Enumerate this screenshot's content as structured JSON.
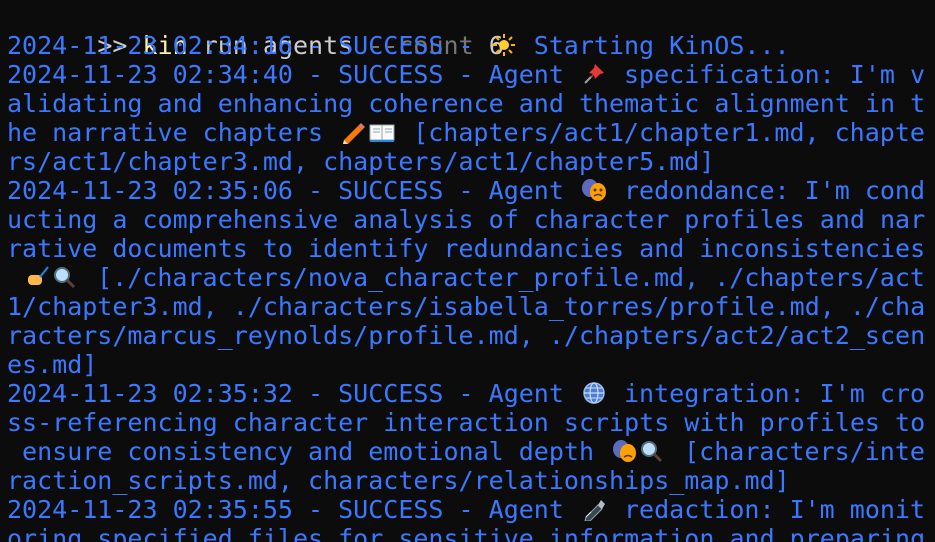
{
  "window": {
    "title": ""
  },
  "command": {
    "prompt": ">>",
    "name": "kin",
    "args": "run agents",
    "flag": "--count",
    "value": "6"
  },
  "lines": [
    {
      "kind": "text",
      "t1": "2024-11-23 02:34:16 - SUCCESS - ",
      "icon": "sun-icon",
      "t2": " Starting KinOS..."
    },
    {
      "kind": "text",
      "t1": "2024-11-23 02:34:40 - SUCCESS - Agent ",
      "icon": "pushpin-icon",
      "t2": " specification: I'm v"
    },
    {
      "kind": "text",
      "t1": "alidating and enhancing coherence and thematic alignment in t"
    },
    {
      "kind": "text",
      "t1": "he narrative chapters ",
      "icon": "pencil-book-icon",
      "t2": " [chapters/act1/chapter1.md, chapte"
    },
    {
      "kind": "text",
      "t1": "rs/act1/chapter3.md, chapters/act1/chapter5.md]"
    },
    {
      "kind": "text",
      "t1": "2024-11-23 02:35:06 - SUCCESS - Agent ",
      "icon": "theater-masks-icon",
      "t2": " redondance: I'm cond"
    },
    {
      "kind": "text",
      "t1": "ucting a comprehensive analysis of character profiles and nar"
    },
    {
      "kind": "text",
      "t1": "rative documents to identify redundancies and inconsistencies"
    },
    {
      "kind": "text",
      "t1": " ",
      "icon": "writing-hand-magnifier-icon",
      "t2": " [./characters/nova_character_profile.md, ./chapters/act"
    },
    {
      "kind": "text",
      "t1": "1/chapter3.md, ./characters/isabella_torres/profile.md, ./cha"
    },
    {
      "kind": "text",
      "t1": "racters/marcus_reynolds/profile.md, ./chapters/act2/act2_scen"
    },
    {
      "kind": "text",
      "t1": "es.md]"
    },
    {
      "kind": "text",
      "t1": "2024-11-23 02:35:32 - SUCCESS - Agent ",
      "icon": "globe-icon",
      "t2": " integration: I'm cro"
    },
    {
      "kind": "text",
      "t1": "ss-referencing character interaction scripts with profiles to"
    },
    {
      "kind": "text",
      "t1": " ensure consistency and emotional depth ",
      "icon": "masks-magnifier-icon",
      "t2": " [characters/inte"
    },
    {
      "kind": "text",
      "t1": "raction_scripts.md, characters/relationships_map.md]"
    },
    {
      "kind": "text",
      "t1": "2024-11-23 02:35:55 - SUCCESS - Agent ",
      "icon": "fountain-pen-icon",
      "t2": " redaction: I'm monit"
    },
    {
      "kind": "text",
      "t1": "oring specified files for sensitive information and preparing"
    }
  ],
  "colors": {
    "background": "#0c0c0c",
    "log_text": "#3b78ff",
    "command_name": "#f9f1a5",
    "flag": "#767676",
    "default_text": "#cccccc"
  }
}
